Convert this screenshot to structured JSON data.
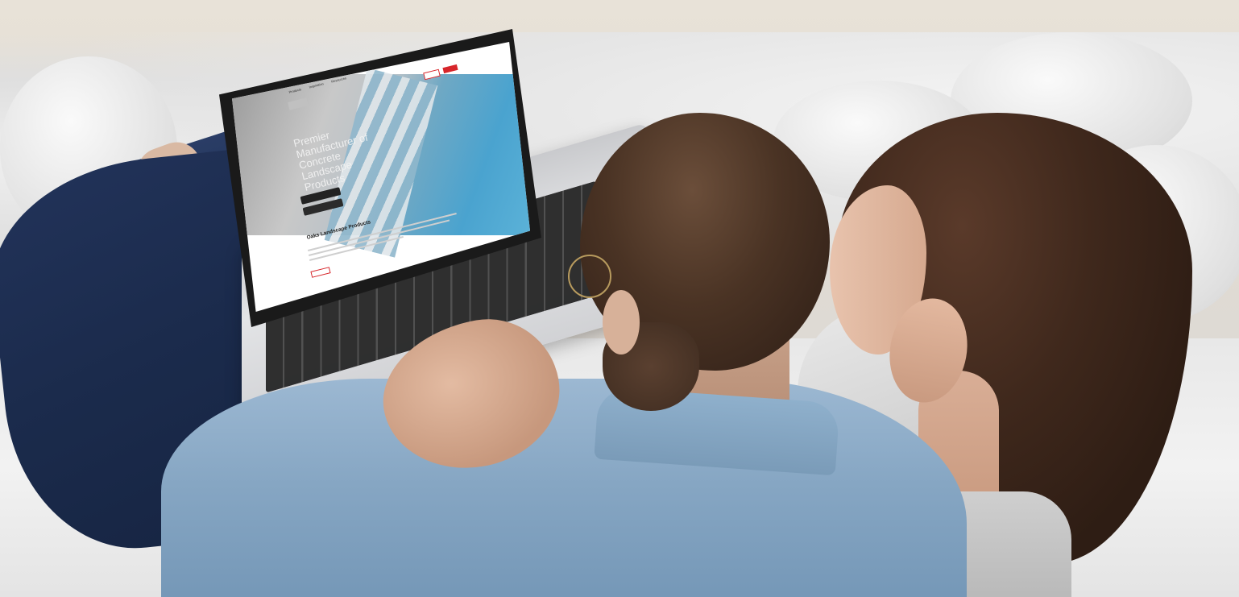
{
  "photo": {
    "subject": "",
    "screen": {
      "nav_items": [
        "Products",
        "Inspiration",
        "Resources"
      ],
      "buttons": [
        "",
        ""
      ],
      "hero_title": "Premier Manufacturer of Concrete Landscape Products",
      "section_title": "Oaks Landscape Products"
    }
  },
  "colors": {
    "accent_red": "#d7262b",
    "shirt_blue": "#86a6c3",
    "jeans_navy": "#1b2b4c",
    "pool_blue": "#4aa3cf"
  }
}
